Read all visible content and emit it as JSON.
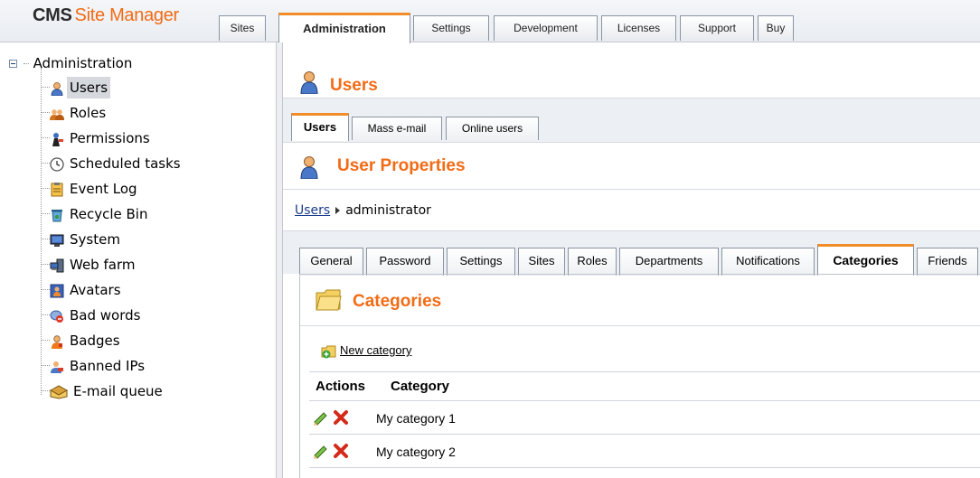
{
  "header": {
    "logo_cms": "CMS",
    "logo_site_manager": "Site Manager",
    "tabs": [
      {
        "label": "Sites"
      },
      {
        "label": "Administration",
        "active": true
      },
      {
        "label": "Settings"
      },
      {
        "label": "Development"
      },
      {
        "label": "Licenses"
      },
      {
        "label": "Support"
      },
      {
        "label": "Buy"
      }
    ]
  },
  "tree": {
    "root_label": "Administration",
    "items": [
      {
        "label": "Users",
        "icon": "user-icon",
        "selected": true
      },
      {
        "label": "Roles",
        "icon": "roles-icon"
      },
      {
        "label": "Permissions",
        "icon": "permissions-icon"
      },
      {
        "label": "Scheduled tasks",
        "icon": "clock-icon"
      },
      {
        "label": "Event Log",
        "icon": "event-log-icon"
      },
      {
        "label": "Recycle Bin",
        "icon": "recycle-bin-icon"
      },
      {
        "label": "System",
        "icon": "monitor-icon"
      },
      {
        "label": "Web farm",
        "icon": "web-farm-icon"
      },
      {
        "label": "Avatars",
        "icon": "avatar-icon"
      },
      {
        "label": "Bad words",
        "icon": "bad-words-icon"
      },
      {
        "label": "Badges",
        "icon": "badge-icon"
      },
      {
        "label": "Banned IPs",
        "icon": "banned-ip-icon"
      },
      {
        "label": "E-mail queue",
        "icon": "email-queue-icon"
      }
    ]
  },
  "main": {
    "section_title": "Users",
    "subtabs": [
      {
        "label": "Users",
        "active": true
      },
      {
        "label": "Mass e-mail"
      },
      {
        "label": "Online users"
      }
    ],
    "props_title": "User Properties",
    "breadcrumb": {
      "link": "Users",
      "current": "administrator"
    },
    "prop_tabs": [
      {
        "label": "General"
      },
      {
        "label": "Password"
      },
      {
        "label": "Settings"
      },
      {
        "label": "Sites"
      },
      {
        "label": "Roles"
      },
      {
        "label": "Departments"
      },
      {
        "label": "Notifications"
      },
      {
        "label": "Categories",
        "active": true
      },
      {
        "label": "Friends"
      }
    ],
    "categories_title": "Categories",
    "new_category_label": "New category",
    "grid": {
      "columns": [
        "Actions",
        "Category"
      ],
      "rows": [
        {
          "category": "My category 1"
        },
        {
          "category": "My category 2"
        }
      ]
    }
  },
  "colors": {
    "accent": "#f26b15",
    "tab_active_border": "#f28c28",
    "link": "#1a3c8a"
  }
}
